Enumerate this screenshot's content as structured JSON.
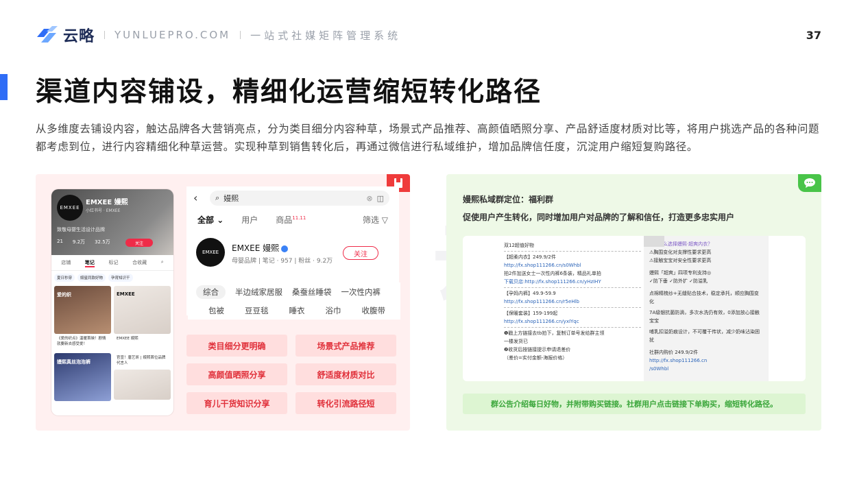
{
  "header": {
    "brand": "云略",
    "domain": "YUNLUEPRO.COM",
    "slogan": "一站式社媒矩阵管理系统",
    "page_number": "37"
  },
  "title": "渠道内容铺设，精细化运营缩短转化路径",
  "description": "从多维度去铺设内容，触达品牌各大营销亮点，分为类目细分内容种草，场景式产品推荐、高颜值晒照分享、产品舒适度材质对比等，将用户挑选产品的各种问题都考虑到位，进行内容精细化种草运营。实现种草到销售转化后，再通过微信进行私域维护，增加品牌信任度，沉淀用户缩短复购路径。",
  "watermark": "云略",
  "left_panel": {
    "phone_a": {
      "avatar": "EMXEE",
      "name": "EMXEE 嫚熙",
      "sub": "小红书号 · EMXEE",
      "tag": "致敬母婴生活设计品牌",
      "stats": [
        "21",
        "9.2万",
        "32.5万"
      ],
      "follow": "关注",
      "tabs": [
        "店铺",
        "笔记",
        "标记",
        "合收藏"
      ],
      "chips": [
        "夏日秒穿",
        "嫚星同款好物",
        "孕育知识干"
      ],
      "cards": [
        {
          "text": "爱的织",
          "caption": "《爱的织点》温暖首映！剧情就要新去感受爱！"
        },
        {
          "text": "EMXEE",
          "caption": "EMXEE 嫚熙"
        },
        {
          "text": "嫚熙真丝泡泡裤",
          "caption": "嫚熙真丝泡泡裤"
        },
        {
          "text": "",
          "caption": "官宣！唐艺昕 | 嫚熙首位品牌代言人"
        }
      ]
    },
    "phone_b": {
      "search_text": "嫚熙",
      "tabs": [
        "全部",
        "用户",
        "商品",
        "筛选"
      ],
      "tab_badge": "11.11",
      "avatar": "EMXEE",
      "name": "EMXEE 嫚熙",
      "meta": "母婴品牌 | 笔记 · 957 | 粉丝 · 9.2万",
      "follow": "关注"
    },
    "tags_row1": [
      "综合",
      "半边绒家居服",
      "桑蚕丝睡袋",
      "一次性内裤"
    ],
    "tags_row2": [
      "包被",
      "豆豆毯",
      "睡衣",
      "浴巾",
      "收腹带"
    ],
    "features": [
      "类目细分更明确",
      "场景式产品推荐",
      "高颜值晒照分享",
      "舒适度材质对比",
      "育儿干货知识分享",
      "转化引流路径短"
    ]
  },
  "right_panel": {
    "heading1": "嫚熙私域群定位：福利群",
    "heading2": "促使用户产生转化，同时增加用户对品牌的了解和信任，打造更多忠实用户",
    "msg1": {
      "lines": [
        "双12超值好物",
        "【超柔内衣】249.9/2件",
        "http://fx.shop111266.cn/s0Whbl",
        "拍2件加送女士一次性内裤6条装，精品礼单拍",
        "下载贝店:http://fx.shop111266.cn/yHzIHY",
        "【孕妈内裤】49.9-59.9",
        "http://fx.shop111266.cn/r5eHlb",
        "【保暖套装】159-199起",
        "http://fx.shop111266.cn/yxIYqc",
        "❶戳上方链接去tb拍下，复制订单号发给群主领",
        "一楼发货已",
        "❷收货后按链接提示申请退差价",
        "（差价=实付金额-海报价格）"
      ]
    },
    "msg2": {
      "lines": [
        "#为什么选择嫚熙·超爽内衣？",
        "⚠胸围变化对支撑性要求更高",
        "⚠接触宝宝对安全性要求更高",
        "嫚熙「超爽」四项专利支持◎",
        "✓防下垂 ✓防外扩 ✓防溢乳",
        "点棉精梳纱+无缝贴合技术，稳定承托，顺应胸围变化",
        "7A级银抗菌防滴，多次水洗仍有效，0添加放心接触宝宝",
        "哺乳扣溢奶痕设计，不可覆干传状，减少奶味沾染困扰",
        "社群内购价 249.9/2件",
        "http://fx.shop111266.cn",
        "/s0Whbl"
      ]
    },
    "banner": "群公告介绍每日好物，并附带购买链接。社群用户点击链接下单购买，缩短转化路径。"
  },
  "colors": {
    "accent": "#2f6df6",
    "red": "#e0303a",
    "green": "#3aa63a"
  }
}
